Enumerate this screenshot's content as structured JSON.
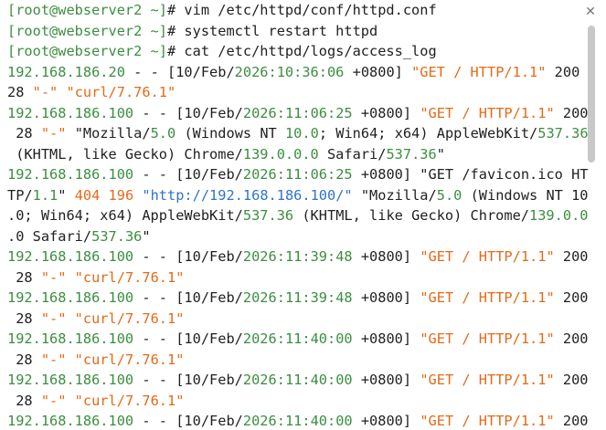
{
  "terminal": {
    "close_glyph": "✕",
    "scroll_fraction": 0.32,
    "lines": [
      [
        {
          "t": "[root@webserver2 ~]",
          "c": "prompt"
        },
        {
          "t": "# vim /etc/httpd/conf/httpd.conf",
          "c": "plain"
        }
      ],
      [
        {
          "t": "[root@webserver2 ~]",
          "c": "prompt"
        },
        {
          "t": "# systemctl restart httpd",
          "c": "plain"
        }
      ],
      [
        {
          "t": "[root@webserver2 ~]",
          "c": "prompt"
        },
        {
          "t": "# cat /etc/httpd/logs/access_log",
          "c": "plain"
        }
      ],
      [
        {
          "t": "192.168.186.20",
          "c": "green"
        },
        {
          "t": " - - [10/Feb/",
          "c": "plain"
        },
        {
          "t": "2026:10:36:06",
          "c": "green"
        },
        {
          "t": " +0800] ",
          "c": "plain"
        },
        {
          "t": "\"GET / HTTP/1.1\"",
          "c": "orange"
        },
        {
          "t": " 200",
          "c": "plain"
        }
      ],
      [
        {
          "t": "28 ",
          "c": "plain"
        },
        {
          "t": "\"-\" \"curl/7.76.1\"",
          "c": "orange"
        }
      ],
      [
        {
          "t": "192.168.186.100",
          "c": "green"
        },
        {
          "t": " - - [10/Feb/",
          "c": "plain"
        },
        {
          "t": "2026:11:06:25",
          "c": "green"
        },
        {
          "t": " +0800] ",
          "c": "plain"
        },
        {
          "t": "\"GET / HTTP/1.1\"",
          "c": "orange"
        },
        {
          "t": " 200",
          "c": "plain"
        }
      ],
      [
        {
          "t": " 28 ",
          "c": "plain"
        },
        {
          "t": "\"-\"",
          "c": "orange"
        },
        {
          "t": " \"Mozilla/",
          "c": "plain"
        },
        {
          "t": "5.0",
          "c": "green"
        },
        {
          "t": " (Windows NT ",
          "c": "plain"
        },
        {
          "t": "10.0",
          "c": "green"
        },
        {
          "t": "; Win64; x64) AppleWebKit/",
          "c": "plain"
        },
        {
          "t": "537.36",
          "c": "green"
        }
      ],
      [
        {
          "t": " (KHTML, like Gecko) Chrome/",
          "c": "plain"
        },
        {
          "t": "139.0.0.0",
          "c": "green"
        },
        {
          "t": " Safari/",
          "c": "plain"
        },
        {
          "t": "537.36",
          "c": "green"
        },
        {
          "t": "\"",
          "c": "plain"
        }
      ],
      [
        {
          "t": "192.168.186.100",
          "c": "green"
        },
        {
          "t": " - - [10/Feb/",
          "c": "plain"
        },
        {
          "t": "2026:11:06:25",
          "c": "green"
        },
        {
          "t": " +0800] \"GET /favicon.ico HT",
          "c": "plain"
        }
      ],
      [
        {
          "t": "TP/",
          "c": "plain"
        },
        {
          "t": "1.1",
          "c": "green"
        },
        {
          "t": "\" ",
          "c": "plain"
        },
        {
          "t": "404 196",
          "c": "orange"
        },
        {
          "t": " \"http://192.168.186.100/\"",
          "c": "blue"
        },
        {
          "t": " \"Mozilla/",
          "c": "plain"
        },
        {
          "t": "5.0",
          "c": "green"
        },
        {
          "t": " (Windows NT 10",
          "c": "plain"
        }
      ],
      [
        {
          "t": ".0; Win64; x64) AppleWebKit/",
          "c": "plain"
        },
        {
          "t": "537.36",
          "c": "green"
        },
        {
          "t": " (KHTML, like Gecko) Chrome/",
          "c": "plain"
        },
        {
          "t": "139.0.0",
          "c": "green"
        }
      ],
      [
        {
          "t": ".0 Safari/",
          "c": "plain"
        },
        {
          "t": "537.36",
          "c": "green"
        },
        {
          "t": "\"",
          "c": "plain"
        }
      ],
      [
        {
          "t": "192.168.186.100",
          "c": "green"
        },
        {
          "t": " - - [10/Feb/",
          "c": "plain"
        },
        {
          "t": "2026:11:39:48",
          "c": "green"
        },
        {
          "t": " +0800] ",
          "c": "plain"
        },
        {
          "t": "\"GET / HTTP/1.1\"",
          "c": "orange"
        },
        {
          "t": " 200",
          "c": "plain"
        }
      ],
      [
        {
          "t": " 28 ",
          "c": "plain"
        },
        {
          "t": "\"-\" \"curl/7.76.1\"",
          "c": "orange"
        }
      ],
      [
        {
          "t": "192.168.186.100",
          "c": "green"
        },
        {
          "t": " - - [10/Feb/",
          "c": "plain"
        },
        {
          "t": "2026:11:39:48",
          "c": "green"
        },
        {
          "t": " +0800] ",
          "c": "plain"
        },
        {
          "t": "\"GET / HTTP/1.1\"",
          "c": "orange"
        },
        {
          "t": " 200",
          "c": "plain"
        }
      ],
      [
        {
          "t": " 28 ",
          "c": "plain"
        },
        {
          "t": "\"-\" \"curl/7.76.1\"",
          "c": "orange"
        }
      ],
      [
        {
          "t": "192.168.186.100",
          "c": "green"
        },
        {
          "t": " - - [10/Feb/",
          "c": "plain"
        },
        {
          "t": "2026:11:40:00",
          "c": "green"
        },
        {
          "t": " +0800] ",
          "c": "plain"
        },
        {
          "t": "\"GET / HTTP/1.1\"",
          "c": "orange"
        },
        {
          "t": " 200",
          "c": "plain"
        }
      ],
      [
        {
          "t": " 28 ",
          "c": "plain"
        },
        {
          "t": "\"-\" \"curl/7.76.1\"",
          "c": "orange"
        }
      ],
      [
        {
          "t": "192.168.186.100",
          "c": "green"
        },
        {
          "t": " - - [10/Feb/",
          "c": "plain"
        },
        {
          "t": "2026:11:40:00",
          "c": "green"
        },
        {
          "t": " +0800] ",
          "c": "plain"
        },
        {
          "t": "\"GET / HTTP/1.1\"",
          "c": "orange"
        },
        {
          "t": " 200",
          "c": "plain"
        }
      ],
      [
        {
          "t": " 28 ",
          "c": "plain"
        },
        {
          "t": "\"-\" \"curl/7.76.1\"",
          "c": "orange"
        }
      ],
      [
        {
          "t": "192.168.186.100",
          "c": "green"
        },
        {
          "t": " - - [10/Feb/",
          "c": "plain"
        },
        {
          "t": "2026:11:40:00",
          "c": "green"
        },
        {
          "t": " +0800] ",
          "c": "plain"
        },
        {
          "t": "\"GET / HTTP/1.1\"",
          "c": "orange"
        },
        {
          "t": " 200",
          "c": "plain"
        }
      ]
    ]
  },
  "colors": {
    "prompt": "#3c8e40",
    "number": "#3c8e40",
    "string": "#e46a17",
    "url": "#2f74c6",
    "text": "#1f1f1f",
    "background": "#ffffff"
  }
}
